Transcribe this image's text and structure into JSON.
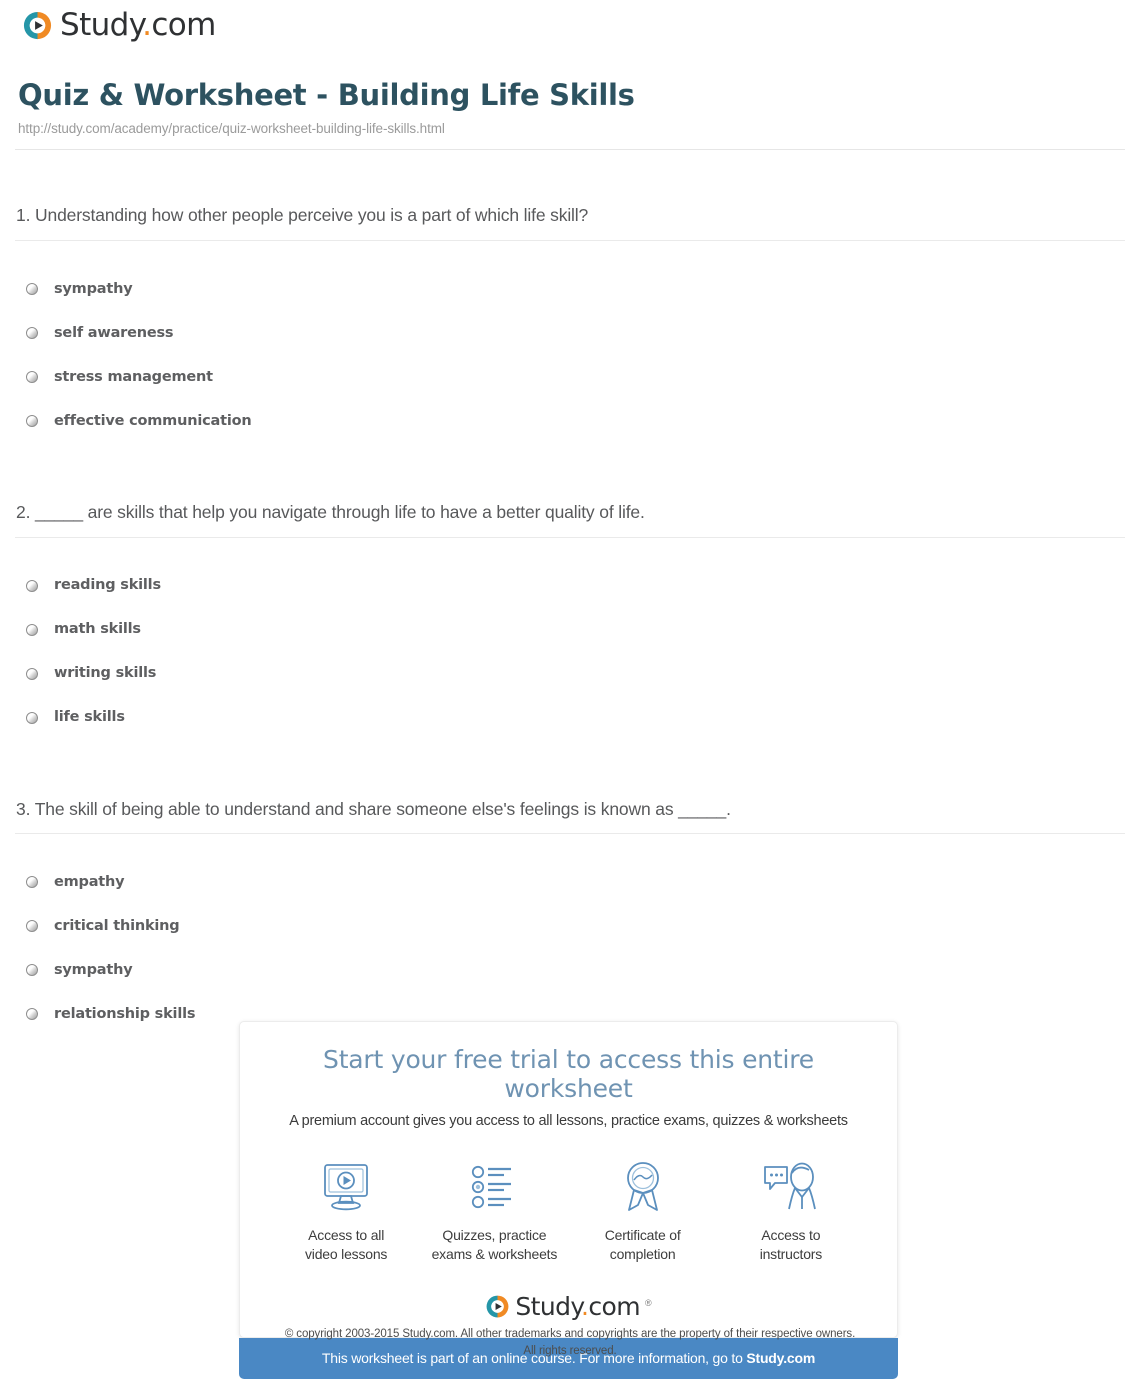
{
  "brand": {
    "name_main": "Study",
    "name_dot": ".",
    "name_tld": "com",
    "trademark": "®",
    "mark_icon": "play-circle-icon",
    "accent_teal": "#2596a8",
    "accent_orange": "#f08a24",
    "wordmark_color": "#2f3133"
  },
  "header": {
    "title": "Quiz & Worksheet - Building Life Skills",
    "url": "http://study.com/academy/practice/quiz-worksheet-building-life-skills.html",
    "title_color": "#2d5260"
  },
  "quiz": {
    "questions": [
      {
        "number": "1.",
        "text": "1. Understanding how other people perceive you is a part of which life skill?",
        "options": [
          "sympathy",
          "self awareness",
          "stress management",
          "effective communication"
        ]
      },
      {
        "number": "2.",
        "text": "2. _____ are skills that help you navigate through life to have a better quality of life.",
        "options": [
          "reading skills",
          "math skills",
          "writing skills",
          "life skills"
        ]
      },
      {
        "number": "3.",
        "text": "3. The skill of being able to understand and share someone else's feelings is known as _____.",
        "options": [
          "empathy",
          "critical thinking",
          "sympathy",
          "relationship skills"
        ]
      }
    ]
  },
  "promo": {
    "heading": "Start your free trial to access this entire worksheet",
    "subheading": "A premium account gives you access to all lessons, practice exams, quizzes & worksheets",
    "heading_color": "#6f93b2",
    "benefits": [
      {
        "icon": "monitor-play-icon",
        "line1": "Access to all",
        "line2": "video lessons"
      },
      {
        "icon": "quiz-list-icon",
        "line1": "Quizzes, practice",
        "line2": "exams & worksheets"
      },
      {
        "icon": "award-ribbon-icon",
        "line1": "Certificate of",
        "line2": "completion"
      },
      {
        "icon": "instructor-chat-icon",
        "line1": "Access to",
        "line2": "instructors"
      }
    ],
    "banner_text_before": "This worksheet is part of an online course. For more information, go to ",
    "banner_link_text": "Study.com",
    "banner_color": "#4a88c4"
  },
  "footer": {
    "copyright_line1": "© copyright 2003-2015 Study.com. All other trademarks and copyrights are the property of their respective owners.",
    "copyright_line2": "All rights reserved."
  }
}
